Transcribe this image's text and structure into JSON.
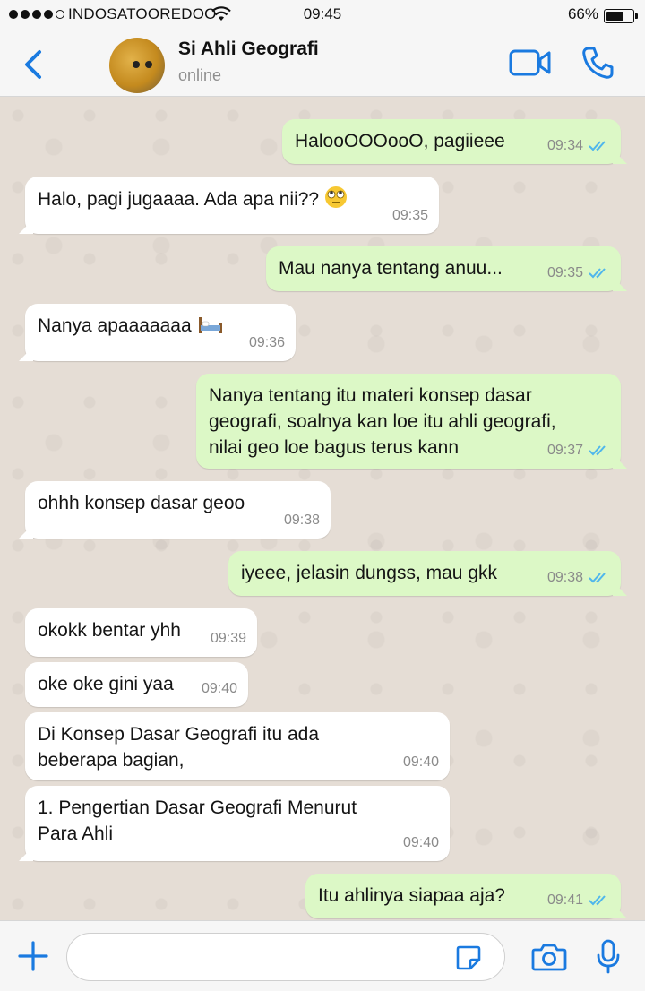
{
  "status_bar": {
    "carrier": "INDOSATOOREDOO",
    "time": "09:45",
    "battery": "66%",
    "battery_level": 0.66
  },
  "header": {
    "contact_name": "Si Ahli Geografi",
    "contact_status": "online"
  },
  "messages": [
    {
      "direction": "out",
      "text": "HalooOOOooO, pagiieee",
      "time": "09:34",
      "read": true
    },
    {
      "direction": "in",
      "text": "Halo, pagi jugaaaa. Ada apa nii??",
      "emoji": "eye-roll-emoji",
      "time": "09:35"
    },
    {
      "direction": "out",
      "text": "Mau nanya tentang anuu...",
      "time": "09:35",
      "read": true
    },
    {
      "direction": "in",
      "text": "Nanya apaaaaaaa",
      "emoji": "bed-emoji",
      "time": "09:36"
    },
    {
      "direction": "out",
      "text": "Nanya tentang itu materi konsep dasar\ngeografi, soalnya kan loe itu ahli geografi,\nnilai geo loe bagus terus kann",
      "time": "09:37",
      "read": true
    },
    {
      "direction": "in",
      "text": "ohhh konsep dasar geoo",
      "time": "09:38"
    },
    {
      "direction": "out",
      "text": "iyeee, jelasin dungss, mau gkk",
      "time": "09:38",
      "read": true
    },
    {
      "direction": "in",
      "text": "okokk bentar yhh",
      "time": "09:39"
    },
    {
      "direction": "in",
      "text": "oke oke gini yaa",
      "time": "09:40"
    },
    {
      "direction": "in",
      "text": "Di Konsep Dasar Geografi itu ada\nbeberapa bagian,",
      "time": "09:40"
    },
    {
      "direction": "in",
      "text": "1. Pengertian Dasar Geografi Menurut\nPara Ahli",
      "time": "09:40"
    },
    {
      "direction": "out",
      "text": "Itu ahlinya siapaa aja?",
      "time": "09:41",
      "read": true
    }
  ],
  "input": {
    "placeholder": ""
  },
  "colors": {
    "accent": "#1a7ae0",
    "outgoing_bubble": "#dcf8c6",
    "incoming_bubble": "#ffffff",
    "read_ticks": "#4fb6ec",
    "chat_background": "#e5ddd5"
  },
  "icons": [
    "back-chevron-icon",
    "video-call-icon",
    "phone-icon",
    "plus-icon",
    "sticker-icon",
    "camera-icon",
    "microphone-icon",
    "wifi-icon",
    "double-check-icon"
  ]
}
